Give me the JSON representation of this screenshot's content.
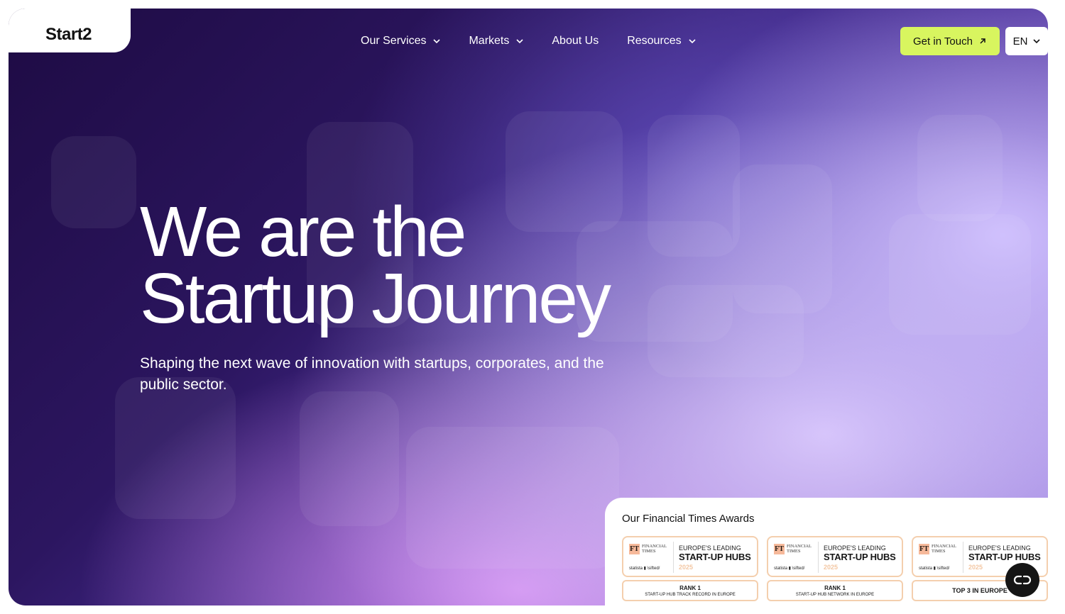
{
  "brand": {
    "logo": "Start2"
  },
  "nav": {
    "items": [
      {
        "label": "Our Services",
        "dropdown": true
      },
      {
        "label": "Markets",
        "dropdown": true
      },
      {
        "label": "About Us",
        "dropdown": false
      },
      {
        "label": "Resources",
        "dropdown": true
      }
    ],
    "cta_label": "Get in Touch",
    "language": "EN"
  },
  "hero": {
    "headline_line1": "We are the",
    "headline_line2": "Startup Journey",
    "subheadline": "Shaping the next wave of innovation with startups, corporates, and the public sector."
  },
  "awards": {
    "title": "Our Financial Times Awards",
    "items": [
      {
        "ft_mark": "FT",
        "ft_line1": "FINANCIAL",
        "ft_line2": "TIMES",
        "partners": "statista ▮  \\sifted/",
        "top": "EUROPE'S LEADING",
        "main": "START-UP HUBS",
        "year": "2025",
        "rank_title": "RANK 1",
        "rank_sub": "START-UP HUB TRACK RECORD IN EUROPE"
      },
      {
        "ft_mark": "FT",
        "ft_line1": "FINANCIAL",
        "ft_line2": "TIMES",
        "partners": "statista ▮  \\sifted/",
        "top": "EUROPE'S LEADING",
        "main": "START-UP HUBS",
        "year": "2025",
        "rank_title": "RANK 1",
        "rank_sub": "START-UP HUB NETWORK IN EUROPE"
      },
      {
        "ft_mark": "FT",
        "ft_line1": "FINANCIAL",
        "ft_line2": "TIMES",
        "partners": "statista ▮  \\sifted/",
        "top": "EUROPE'S LEADING",
        "main": "START-UP HUBS",
        "year": "2025",
        "rank_title": "TOP 3 IN EUROPE"
      }
    ]
  },
  "icons": {
    "dropdown": "chevron-down-icon",
    "cta": "arrow-up-right-icon",
    "chat": "chat-icon"
  },
  "colors": {
    "cta_bg": "#d8f55f",
    "hero_dark": "#1e0b44",
    "hero_light": "#cdbdfd",
    "award_border": "#f4cfae"
  }
}
